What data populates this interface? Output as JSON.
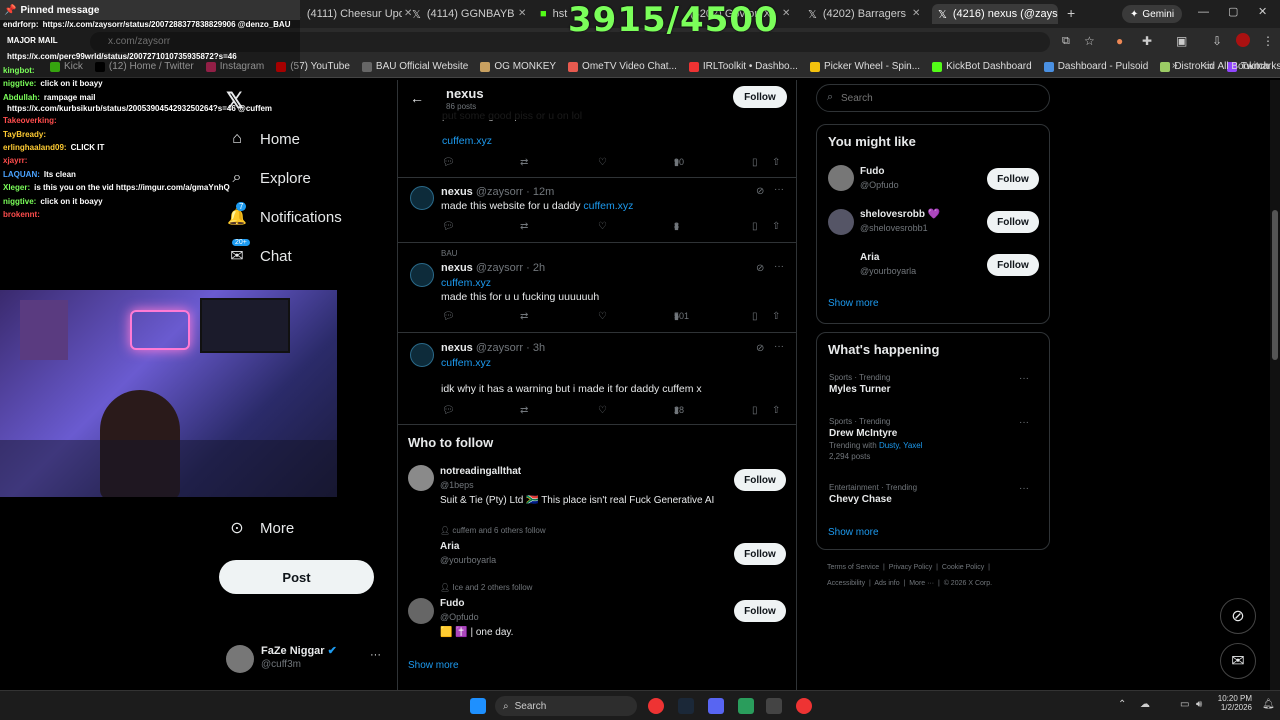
{
  "score": "3915/4500",
  "browser": {
    "tabs": [
      {
        "label": "(4111) Cheesur Updates"
      },
      {
        "label": "(4114) GGNBAYB on X"
      },
      {
        "label": "hst"
      },
      {
        "label": "(4202) Gov on X: @Ra"
      },
      {
        "label": "(4202) Barragers on X"
      },
      {
        "label": "(4216) nexus (@zaysor"
      }
    ],
    "new_tab": "+",
    "gemini": "Gemini",
    "address": "x.com/zaysorr",
    "bookmarks": [
      {
        "label": "Kick",
        "color": "#53fc18"
      },
      {
        "label": "(12) Home / Twitter",
        "color": "#000000"
      },
      {
        "label": "Instagram",
        "color": "#e1306c"
      },
      {
        "label": "(57) YouTube",
        "color": "#ff0000"
      },
      {
        "label": "BAU Official Website",
        "color": "#666666"
      },
      {
        "label": "OG MONKEY",
        "color": "#c8a060"
      },
      {
        "label": "OmeTV Video Chat...",
        "color": "#e85a4f"
      },
      {
        "label": "IRLToolkit • Dashbo...",
        "color": "#e33"
      },
      {
        "label": "Picker Wheel - Spin...",
        "color": "#f4c20d"
      },
      {
        "label": "KickBot Dashboard",
        "color": "#53fc18"
      },
      {
        "label": "Dashboard - Pulsoid",
        "color": "#4a90e2"
      },
      {
        "label": "DistroKid",
        "color": "#9ccc65"
      },
      {
        "label": "Twitch",
        "color": "#9146ff"
      }
    ],
    "all_bookmarks": "All Bookmarks"
  },
  "chat": {
    "pinned": "Pinned message",
    "lines": [
      {
        "user": "endrforp:",
        "text": "https://x.com/zaysorr/status/2007288377838829906 @denzo_BAU",
        "color": "#ffffff"
      },
      {
        "user": "",
        "text": "MAJOR MAIL",
        "color": "#ffffff"
      },
      {
        "user": "",
        "text": "https://x.com/perc99wrld/status/2007271010735935872?s=46",
        "color": "#ffffff"
      },
      {
        "user": "kingbot:",
        "text": "",
        "color": "#7bff5a"
      },
      {
        "user": "niggtive:",
        "text": "click on it boayy",
        "color": "#7bff5a"
      },
      {
        "user": "Abdullah:",
        "text": "rampage mail",
        "color": "#7bff5a"
      },
      {
        "user": "",
        "text": "https://x.com/kurbsikurb/status/2005390454293250264?s=46 @cuffem",
        "color": "#ffffff"
      },
      {
        "user": "Takeoverking:",
        "text": "",
        "color": "#ff4d4d"
      },
      {
        "user": "TayBready:",
        "text": "",
        "color": "#ffcc33"
      },
      {
        "user": "erlinghaaland09:",
        "text": "CLICK IT",
        "color": "#ffcc33"
      },
      {
        "user": "xjayrr:",
        "text": "",
        "color": "#ff4d4d"
      },
      {
        "user": "LAQUAN:",
        "text": "Its clean",
        "color": "#4aa3ff"
      },
      {
        "user": "Xleger:",
        "text": "is this you on the vid https://imgur.com/a/gmaYnhQ",
        "color": "#7bff5a"
      },
      {
        "user": "niggtive:",
        "text": "click on it boayy",
        "color": "#7bff5a"
      },
      {
        "user": "brokennt:",
        "text": "",
        "color": "#ff4d4d"
      }
    ]
  },
  "nav": {
    "items": [
      {
        "label": "Home",
        "icon": "home-icon"
      },
      {
        "label": "Explore",
        "icon": "search-icon"
      },
      {
        "label": "Notifications",
        "icon": "bell-icon",
        "badge": "7"
      },
      {
        "label": "Chat",
        "icon": "chat-icon",
        "badge": "20+"
      },
      {
        "label": "More",
        "icon": "more-icon"
      }
    ],
    "post": "Post",
    "account_name": "FaZe Niggar",
    "account_handle": "@cuff3m",
    "account_more": "···"
  },
  "profile_header": {
    "name": "nexus",
    "posts": "86 posts",
    "follow": "Follow",
    "partial_text": "put some good piss or u on lol"
  },
  "tweets": [
    {
      "link": "cuffem.xyz",
      "reply": "",
      "retweet": "",
      "like": "",
      "views": "90"
    },
    {
      "name": "nexus",
      "handle": "@zaysorr · 12m",
      "text": "made this website for u daddy",
      "link": "cuffem.xyz",
      "views": "8"
    },
    {
      "context": "BAU",
      "name": "nexus",
      "handle": "@zaysorr · 2h",
      "link": "cuffem.xyz",
      "text": "made this for u u fucking uuuuuuh",
      "views": "501"
    },
    {
      "name": "nexus",
      "handle": "@zaysorr · 3h",
      "link": "cuffem.xyz",
      "text": "idk why it has a warning but i made it for daddy cuffem x",
      "views": "28"
    }
  ],
  "who_to_follow": {
    "title": "Who to follow",
    "people": [
      {
        "context": "",
        "name": "notreadingallthat",
        "handle": "@1beps",
        "bio": "Suit & Tie (Pty) Ltd 🇿🇦 This place isn't real Fuck Generative AI",
        "follow": "Follow"
      },
      {
        "context": "cuffem and 6 others follow",
        "name": "Aria",
        "handle": "@yourboyarla",
        "bio": "",
        "follow": "Follow"
      },
      {
        "context": "Ice and 2 others follow",
        "name": "Fudo",
        "handle": "@Opfudo",
        "bio": "🟨 ✝️ | one day.",
        "follow": "Follow"
      }
    ],
    "show_more": "Show more"
  },
  "search": {
    "placeholder": "Search"
  },
  "you_might_like": {
    "title": "You might like",
    "people": [
      {
        "name": "Fudo",
        "handle": "@Opfudo",
        "follow": "Follow"
      },
      {
        "name": "shelovesrobb 💜",
        "handle": "@shelovesrobb1",
        "follow": "Follow"
      },
      {
        "name": "Aria",
        "handle": "@yourboyarla",
        "follow": "Follow"
      }
    ],
    "show_more": "Show more"
  },
  "whats_happening": {
    "title": "What's happening",
    "trends": [
      {
        "category": "Sports · Trending",
        "title": "Myles Turner",
        "sub": ""
      },
      {
        "category": "Sports · Trending",
        "title": "Drew McIntyre",
        "sub_prefix": "Trending with ",
        "sub_links": "Dusty, Yaxel",
        "sub": "2,294 posts"
      },
      {
        "category": "Entertainment · Trending",
        "title": "Chevy Chase",
        "sub": ""
      }
    ],
    "show_more": "Show more"
  },
  "footer": {
    "line1": "Terms of Service  |  Privacy Policy  |  Cookie Policy  |",
    "line2": "Accessibility  |  Ads info  |  More ···  |  © 2026 X Corp."
  },
  "taskbar": {
    "search": "Search",
    "time": "10:20 PM",
    "date": "1/2/2026"
  }
}
